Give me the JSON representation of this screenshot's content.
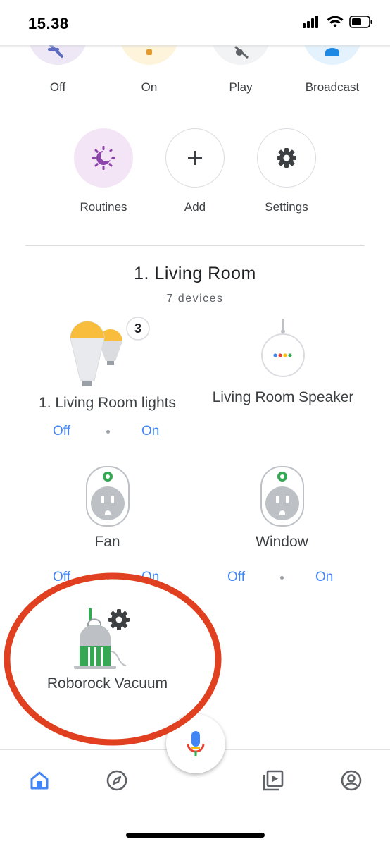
{
  "status_bar": {
    "time": "15.38"
  },
  "quick_actions": [
    {
      "label": "Off",
      "icon": "lights-off-icon",
      "color": "#ede7f6"
    },
    {
      "label": "On",
      "icon": "lights-on-icon",
      "color": "#fef4dc"
    },
    {
      "label": "Play",
      "icon": "music-off-icon",
      "color": "#f1f3f4"
    },
    {
      "label": "Broadcast",
      "icon": "broadcast-icon",
      "color": "#e3f2fd"
    }
  ],
  "actions": [
    {
      "label": "Routines",
      "icon": "routines-icon"
    },
    {
      "label": "Add",
      "icon": "plus-icon"
    },
    {
      "label": "Settings",
      "icon": "gear-icon"
    }
  ],
  "room": {
    "title": "1. Living Room",
    "subtitle": "7 devices",
    "devices": [
      {
        "name": "1. Living Room lights",
        "badge": "3",
        "off": "Off",
        "on": "On",
        "icon": "lightbulb-group-icon"
      },
      {
        "name": "Living Room Speaker",
        "icon": "speaker-icon"
      },
      {
        "name": "Fan",
        "off": "Off",
        "on": "On",
        "icon": "smart-plug-icon"
      },
      {
        "name": "Window",
        "off": "Off",
        "on": "On",
        "icon": "smart-plug-icon"
      },
      {
        "name": "Roborock Vacuum",
        "icon": "vacuum-icon"
      }
    ]
  },
  "bottom_nav": [
    {
      "icon": "home-icon",
      "active": true
    },
    {
      "icon": "compass-icon",
      "active": false
    },
    {
      "icon": "mic-icon",
      "active": false
    },
    {
      "icon": "media-icon",
      "active": false
    },
    {
      "icon": "account-icon",
      "active": false
    }
  ],
  "colors": {
    "accent": "#4285f4",
    "annotation": "#e0401f"
  }
}
